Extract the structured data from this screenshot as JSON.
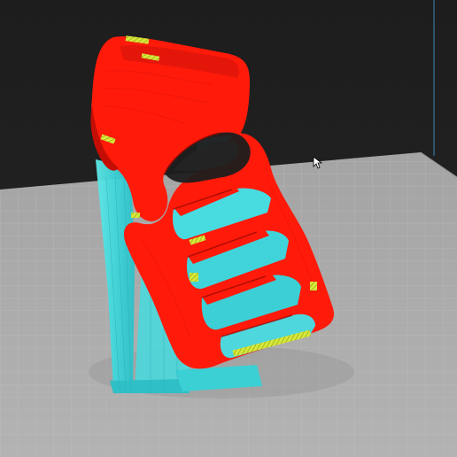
{
  "app": {
    "view": "3d-print-preview"
  },
  "colors": {
    "background": "#1e1e1e",
    "build_plate": "#a9a9a9",
    "grid_line": "#c2c2c2",
    "model_wall": "#ff1a0a",
    "model_wall_dark": "#c40e05",
    "support": "#46e0e0",
    "support_dark": "#1fa7b0",
    "infill": "#c8e02a",
    "axis_line": "#3aa0d8"
  },
  "icons": {
    "cursor": "arrow-cursor-icon"
  }
}
